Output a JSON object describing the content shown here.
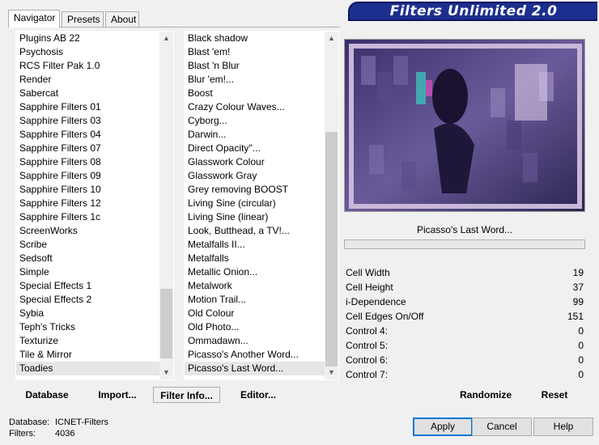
{
  "tabs": [
    "Navigator",
    "Presets",
    "About"
  ],
  "banner": "Filters Unlimited 2.0",
  "categories": [
    "Plugins AB 22",
    "Psychosis",
    "RCS Filter Pak 1.0",
    "Render",
    "Sabercat",
    "Sapphire Filters 01",
    "Sapphire Filters 03",
    "Sapphire Filters 04",
    "Sapphire Filters 07",
    "Sapphire Filters 08",
    "Sapphire Filters 09",
    "Sapphire Filters 10",
    "Sapphire Filters 12",
    "Sapphire Filters 1c",
    "ScreenWorks",
    "Scribe",
    "Sedsoft",
    "Simple",
    "Special Effects 1",
    "Special Effects 2",
    "Sybia",
    "Teph's Tricks",
    "Texturize",
    "Tile & Mirror",
    "Toadies"
  ],
  "selected_category": "Toadies",
  "filters": [
    "Black shadow",
    "Blast 'em!",
    "Blast 'n Blur",
    "Blur 'em!...",
    "Boost",
    "Crazy Colour Waves...",
    "Cyborg...",
    "Darwin...",
    "Direct Opacity''...",
    "Glasswork Colour",
    "Glasswork Gray",
    "Grey removing BOOST",
    "Living Sine (circular)",
    "Living Sine (linear)",
    "Look, Butthead, a TV!...",
    "Metalfalls II...",
    "Metalfalls",
    "Metallic Onion...",
    "Metalwork",
    "Motion Trail...",
    "Old Colour",
    "Old Photo...",
    "Ommadawn...",
    "Picasso's Another Word...",
    "Picasso's Last Word..."
  ],
  "selected_filter": "Picasso's Last Word...",
  "current_filter": "Picasso's Last Word...",
  "params": [
    {
      "label": "Cell Width",
      "value": "19"
    },
    {
      "label": "Cell Height",
      "value": "37"
    },
    {
      "label": "i-Dependence",
      "value": "99"
    },
    {
      "label": "Cell Edges On/Off",
      "value": "151"
    },
    {
      "label": "Control 4:",
      "value": "0"
    },
    {
      "label": "Control 5:",
      "value": "0"
    },
    {
      "label": "Control 6:",
      "value": "0"
    },
    {
      "label": "Control 7:",
      "value": "0"
    }
  ],
  "bottom_buttons": {
    "database": "Database",
    "import": "Import...",
    "filter_info": "Filter Info...",
    "editor": "Editor...",
    "randomize": "Randomize",
    "reset": "Reset"
  },
  "status": {
    "database_label": "Database:",
    "database_value": "ICNET-Filters",
    "filters_label": "Filters:",
    "filters_value": "4036"
  },
  "dialog_buttons": {
    "apply": "Apply",
    "cancel": "Cancel",
    "help": "Help"
  },
  "colors": {
    "accent": "#0078d7",
    "banner": "#1c2f8f"
  }
}
